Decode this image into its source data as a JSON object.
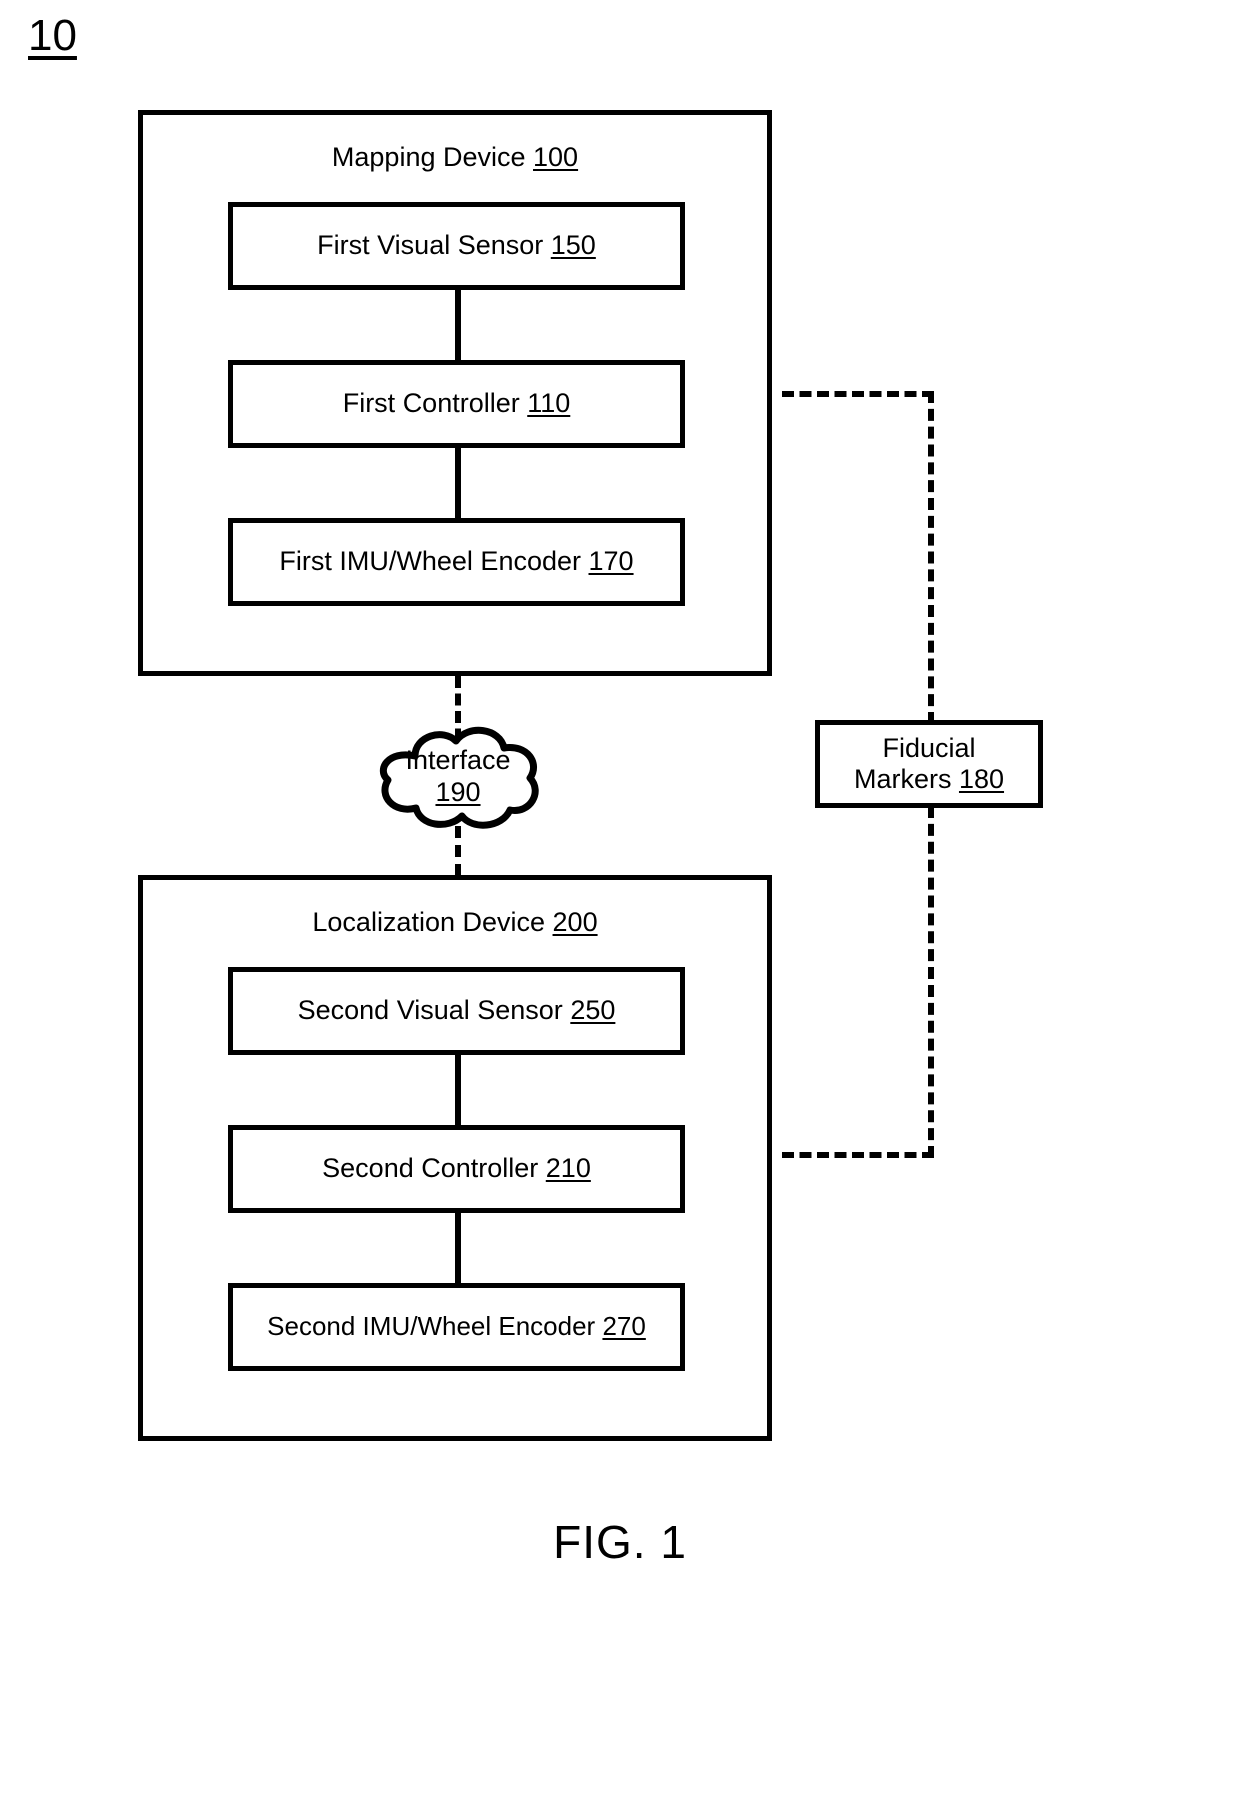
{
  "figure": {
    "number_label": "10",
    "caption": "FIG. 1"
  },
  "mapping_device": {
    "title_text": "Mapping Device ",
    "title_ref": "100",
    "units": [
      {
        "text": "First Visual Sensor ",
        "ref": "150"
      },
      {
        "text": "First Controller ",
        "ref": "110"
      },
      {
        "text": "First IMU/Wheel Encoder ",
        "ref": "170"
      }
    ]
  },
  "localization_device": {
    "title_text": "Localization Device ",
    "title_ref": "200",
    "units": [
      {
        "text": "Second Visual Sensor ",
        "ref": "250"
      },
      {
        "text": "Second Controller ",
        "ref": "210"
      },
      {
        "text": "Second IMU/Wheel Encoder ",
        "ref": "270"
      }
    ]
  },
  "interface_cloud": {
    "label": "Interface",
    "ref": "190"
  },
  "fiducial_markers": {
    "line1": "Fiducial",
    "line2_text": "Markers ",
    "line2_ref": "180"
  },
  "colors": {
    "stroke": "#000000",
    "background": "#ffffff"
  }
}
